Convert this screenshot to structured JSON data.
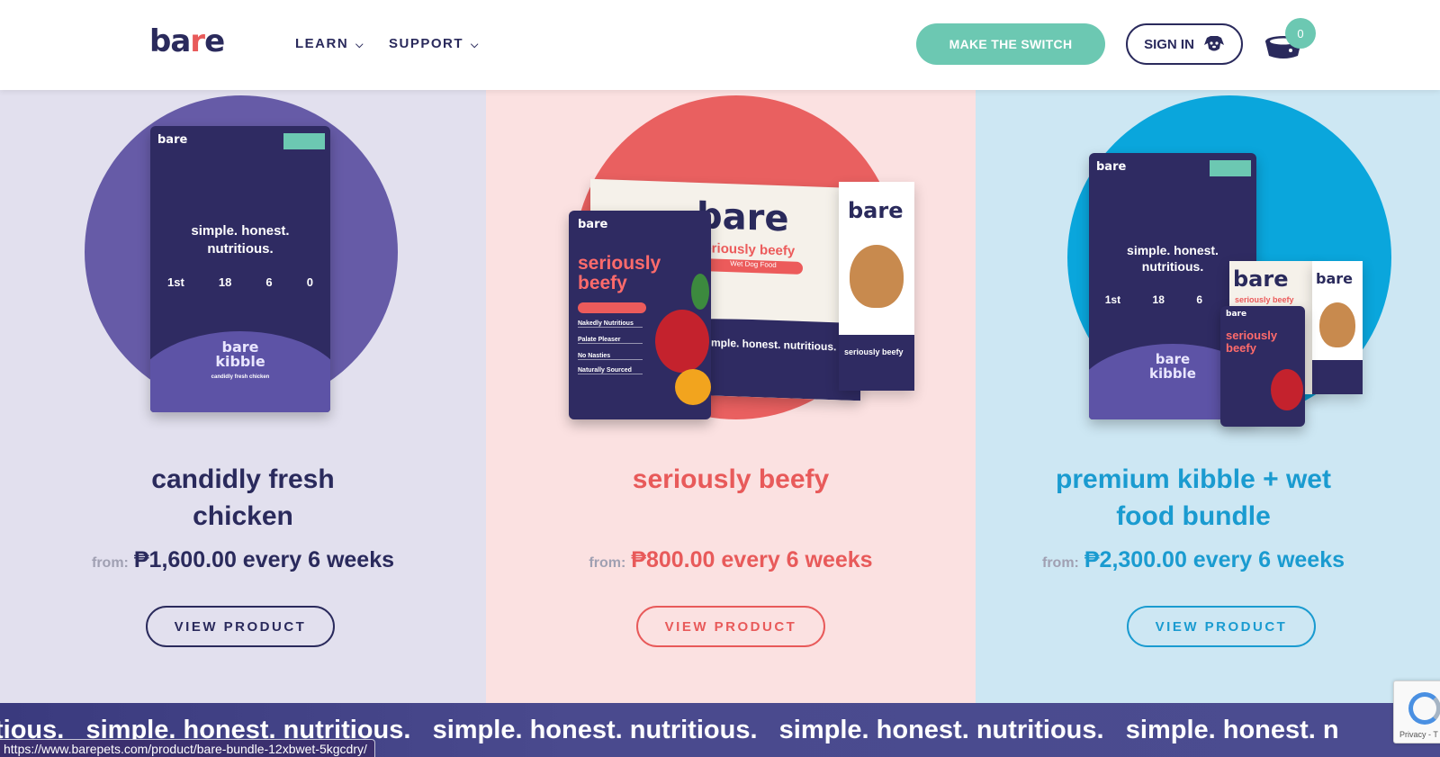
{
  "header": {
    "logo": "bare",
    "nav": [
      {
        "label": "LEARN"
      },
      {
        "label": "SUPPORT"
      }
    ],
    "cta_label": "MAKE THE SWITCH",
    "signin_label": "SIGN IN",
    "cart_count": "0"
  },
  "products": [
    {
      "title_line1": "candidly fresh",
      "title_line2": "chicken",
      "from_label": "from:",
      "price": "₱1,600.00 every 6 weeks",
      "button_label": "VIEW PRODUCT",
      "accent_color": "#2a2a5c",
      "background_color": "#e2e0ee",
      "circle_color": "#665ba7"
    },
    {
      "title_line1": "seriously beefy",
      "title_line2": "",
      "from_label": "from:",
      "price": "₱800.00 every 6 weeks",
      "button_label": "VIEW PRODUCT",
      "accent_color": "#e85a5a",
      "background_color": "#fbe1e1",
      "circle_color": "#e96060"
    },
    {
      "title_line1": "premium kibble + wet",
      "title_line2": "food bundle",
      "from_label": "from:",
      "price": "₱2,300.00 every 6 weeks",
      "button_label": "VIEW PRODUCT",
      "accent_color": "#1a9bd0",
      "background_color": "#cde7f3",
      "circle_color": "#0aa6dc"
    }
  ],
  "packaging": {
    "bag_logo": "bare",
    "bag_slogan_1": "simple. honest.",
    "bag_slogan_2": "nutritious.",
    "bag_stats": [
      "1st",
      "18",
      "6",
      "0"
    ],
    "bag_brand_1": "bare",
    "bag_brand_2": "kibble",
    "bag_flavor": "candidly fresh chicken",
    "pouch_logo": "bare",
    "pouch_title_1": "seriously",
    "pouch_title_2": "beefy",
    "pouch_features": [
      "Nakedly Nutritious",
      "Palate Pleaser",
      "No Nasties",
      "Naturally Sourced"
    ],
    "box_logo": "bare",
    "box_sub": "seriously beefy",
    "box_pill": "Wet Dog Food",
    "box_slogan": "simple. honest. nutritious.",
    "box_side_text": "seriously beefy"
  },
  "marquee": {
    "text": "tious.   simple. honest. nutritious.   simple. honest. nutritious.   simple. honest. nutritious.   simple. honest. n"
  },
  "status_url": "https://www.barepets.com/product/bare-bundle-12xbwet-5kgcdry/",
  "recaptcha_text": "Privacy - T"
}
